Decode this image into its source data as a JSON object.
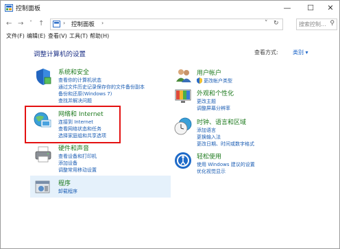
{
  "window": {
    "title": "控制面板"
  },
  "window_controls": {
    "minimize": "—",
    "maximize": "☐",
    "close": "✕"
  },
  "nav": {
    "back": "←",
    "forward": "→",
    "recent": "˅",
    "up": "↑"
  },
  "address": {
    "path": "控制面板",
    "chevron_left": "›",
    "chevron_right": "›",
    "dropdown": "˅",
    "refresh": "↻"
  },
  "search": {
    "placeholder": "搜索控制...",
    "icon": "⚲"
  },
  "menu": [
    "文件(F)",
    "编辑(E)",
    "查看(V)",
    "工具(T)",
    "帮助(H)"
  ],
  "main": {
    "heading": "调整计算机的设置"
  },
  "view": {
    "label": "查看方式:",
    "value": "类别 ▾"
  },
  "categories_left": [
    {
      "title": "系统和安全",
      "icon": "shield-icon",
      "links": [
        "查看你的计算机状态",
        "通过文件历史记录保存你的文件备份副本",
        "备份和还原(Windows 7)",
        "查找并解决问题"
      ]
    },
    {
      "title": "网络和 Internet",
      "icon": "network-globe-icon",
      "links": [
        "连接到 Internet",
        "查看网络状态和任务",
        "选择家庭组和共享选项"
      ]
    },
    {
      "title": "硬件和声音",
      "icon": "printer-icon",
      "links": [
        "查看设备和打印机",
        "添加设备",
        "调整常用移动设置"
      ]
    },
    {
      "title": "程序",
      "icon": "programs-icon",
      "links": [
        "卸载程序"
      ]
    }
  ],
  "categories_right": [
    {
      "title": "用户帐户",
      "icon": "users-icon",
      "links": [
        "更改帐户类型"
      ]
    },
    {
      "title": "外观和个性化",
      "icon": "display-icon",
      "links": [
        "更改主题",
        "调整屏幕分辨率"
      ]
    },
    {
      "title": "时钟、语言和区域",
      "icon": "clock-globe-icon",
      "links": [
        "添加语言",
        "更换输入法",
        "更改日期、时间或数字格式"
      ]
    },
    {
      "title": "轻松使用",
      "icon": "ease-of-access-icon",
      "links": [
        "使用 Windows 建议的设置",
        "优化视觉显示"
      ]
    }
  ],
  "colors": {
    "link": "#1a5cb3",
    "category_title": "#1e7a1e",
    "heading": "#1e3287",
    "highlight": "#e5f1fb",
    "annotation_box": "#e31010"
  }
}
